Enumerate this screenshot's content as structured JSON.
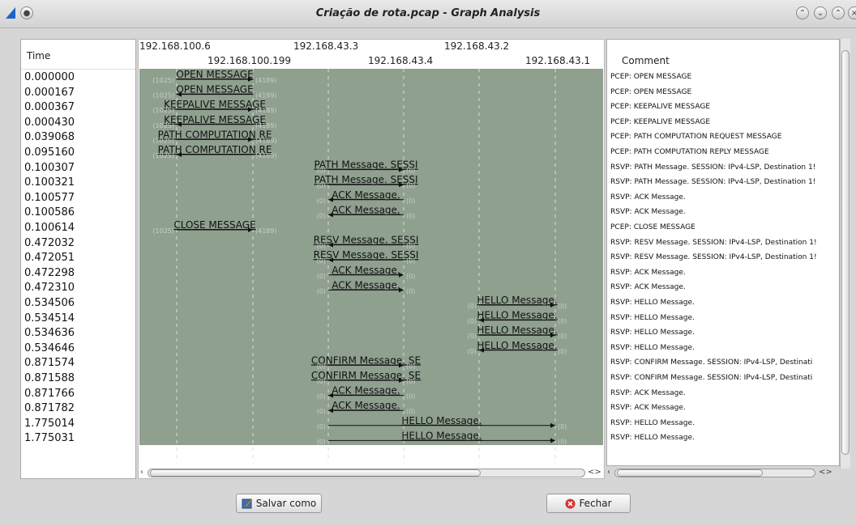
{
  "window": {
    "title": "Criação de rota.pcap - Graph Analysis"
  },
  "headers": {
    "time": "Time",
    "comment": "Comment"
  },
  "hosts_top": [
    "192.168.100.6",
    "192.168.43.3",
    "192.168.43.2"
  ],
  "hosts_bottom": [
    "192.168.100.199",
    "192.168.43.4",
    "192.168.43.1"
  ],
  "rows": [
    {
      "time": "0.000000",
      "comment": "PCEP: OPEN MESSAGE",
      "label": "OPEN MESSAGE",
      "src_port": "(1025)",
      "dst_port": "(4189)"
    },
    {
      "time": "0.000167",
      "comment": "PCEP: OPEN MESSAGE",
      "label": "OPEN MESSAGE",
      "src_port": "(1025)",
      "dst_port": "(4189)"
    },
    {
      "time": "0.000367",
      "comment": "PCEP: KEEPALIVE MESSAGE",
      "label": "KEEPALIVE MESSAGE",
      "src_port": "(1025)",
      "dst_port": "(4189)"
    },
    {
      "time": "0.000430",
      "comment": "PCEP: KEEPALIVE MESSAGE",
      "label": "KEEPALIVE MESSAGE",
      "src_port": "(1025)",
      "dst_port": "(4189)"
    },
    {
      "time": "0.039068",
      "comment": "PCEP: PATH COMPUTATION REQUEST MESSAGE",
      "label": "PATH COMPUTATION RE",
      "src_port": "(1025)",
      "dst_port": "(4189)"
    },
    {
      "time": "0.095160",
      "comment": "PCEP: PATH COMPUTATION REPLY MESSAGE",
      "label": "PATH COMPUTATION RE",
      "src_port": "(1025)",
      "dst_port": "(4189)"
    },
    {
      "time": "0.100307",
      "comment": "RSVP: PATH Message. SESSION: IPv4-LSP, Destination 1!",
      "label": "PATH Message. SESSI",
      "src_port": "(0)",
      "dst_port": "(0)"
    },
    {
      "time": "0.100321",
      "comment": "RSVP: PATH Message. SESSION: IPv4-LSP, Destination 1!",
      "label": "PATH Message. SESSI",
      "src_port": "(0)",
      "dst_port": "(0)"
    },
    {
      "time": "0.100577",
      "comment": "RSVP: ACK Message.",
      "label": "ACK Message.",
      "src_port": "(0)",
      "dst_port": "(0)"
    },
    {
      "time": "0.100586",
      "comment": "RSVP: ACK Message.",
      "label": "ACK Message.",
      "src_port": "(0)",
      "dst_port": "(0)"
    },
    {
      "time": "0.100614",
      "comment": "PCEP: CLOSE MESSAGE",
      "label": "CLOSE MESSAGE",
      "src_port": "(1025)",
      "dst_port": "(4189)"
    },
    {
      "time": "0.472032",
      "comment": "RSVP: RESV Message. SESSION: IPv4-LSP, Destination 1!",
      "label": "RESV Message. SESSI",
      "src_port": "(0)",
      "dst_port": "(0)"
    },
    {
      "time": "0.472051",
      "comment": "RSVP: RESV Message. SESSION: IPv4-LSP, Destination 1!",
      "label": "RESV Message. SESSI",
      "src_port": "(0)",
      "dst_port": "(0)"
    },
    {
      "time": "0.472298",
      "comment": "RSVP: ACK Message.",
      "label": "ACK Message.",
      "src_port": "(0)",
      "dst_port": "(0)"
    },
    {
      "time": "0.472310",
      "comment": "RSVP: ACK Message.",
      "label": "ACK Message.",
      "src_port": "(0)",
      "dst_port": "(0)"
    },
    {
      "time": "0.534506",
      "comment": "RSVP: HELLO Message.",
      "label": "HELLO Message.",
      "src_port": "(0)",
      "dst_port": "(0)"
    },
    {
      "time": "0.534514",
      "comment": "RSVP: HELLO Message.",
      "label": "HELLO Message.",
      "src_port": "(0)",
      "dst_port": "(0)"
    },
    {
      "time": "0.534636",
      "comment": "RSVP: HELLO Message.",
      "label": "HELLO Message.",
      "src_port": "(0)",
      "dst_port": "(0)"
    },
    {
      "time": "0.534646",
      "comment": "RSVP: HELLO Message.",
      "label": "HELLO Message.",
      "src_port": "(0)",
      "dst_port": "(0)"
    },
    {
      "time": "0.871574",
      "comment": "RSVP: CONFIRM Message. SESSION: IPv4-LSP, Destinati",
      "label": "CONFIRM Message. SE",
      "src_port": "(0)",
      "dst_port": "(0)"
    },
    {
      "time": "0.871588",
      "comment": "RSVP: CONFIRM Message. SESSION: IPv4-LSP, Destinati",
      "label": "CONFIRM Message. SE",
      "src_port": "(0)",
      "dst_port": "(0)"
    },
    {
      "time": "0.871766",
      "comment": "RSVP: ACK Message.",
      "label": "ACK Message.",
      "src_port": "(0)",
      "dst_port": "(0)"
    },
    {
      "time": "0.871782",
      "comment": "RSVP: ACK Message.",
      "label": "ACK Message.",
      "src_port": "(0)",
      "dst_port": "(0)"
    },
    {
      "time": "1.775014",
      "comment": "RSVP: HELLO Message.",
      "label": "HELLO Message.",
      "src_port": "(0)",
      "dst_port": "(0)"
    },
    {
      "time": "1.775031",
      "comment": "RSVP: HELLO Message.",
      "label": "HELLO Message.",
      "src_port": "(0)",
      "dst_port": "(0)"
    }
  ],
  "buttons": {
    "save": "Salvar como",
    "close": "Fechar"
  },
  "scroll_arrows": "<>",
  "colors": {
    "graph_bg": "#8fa08f",
    "close_icon": "#d9302a"
  }
}
